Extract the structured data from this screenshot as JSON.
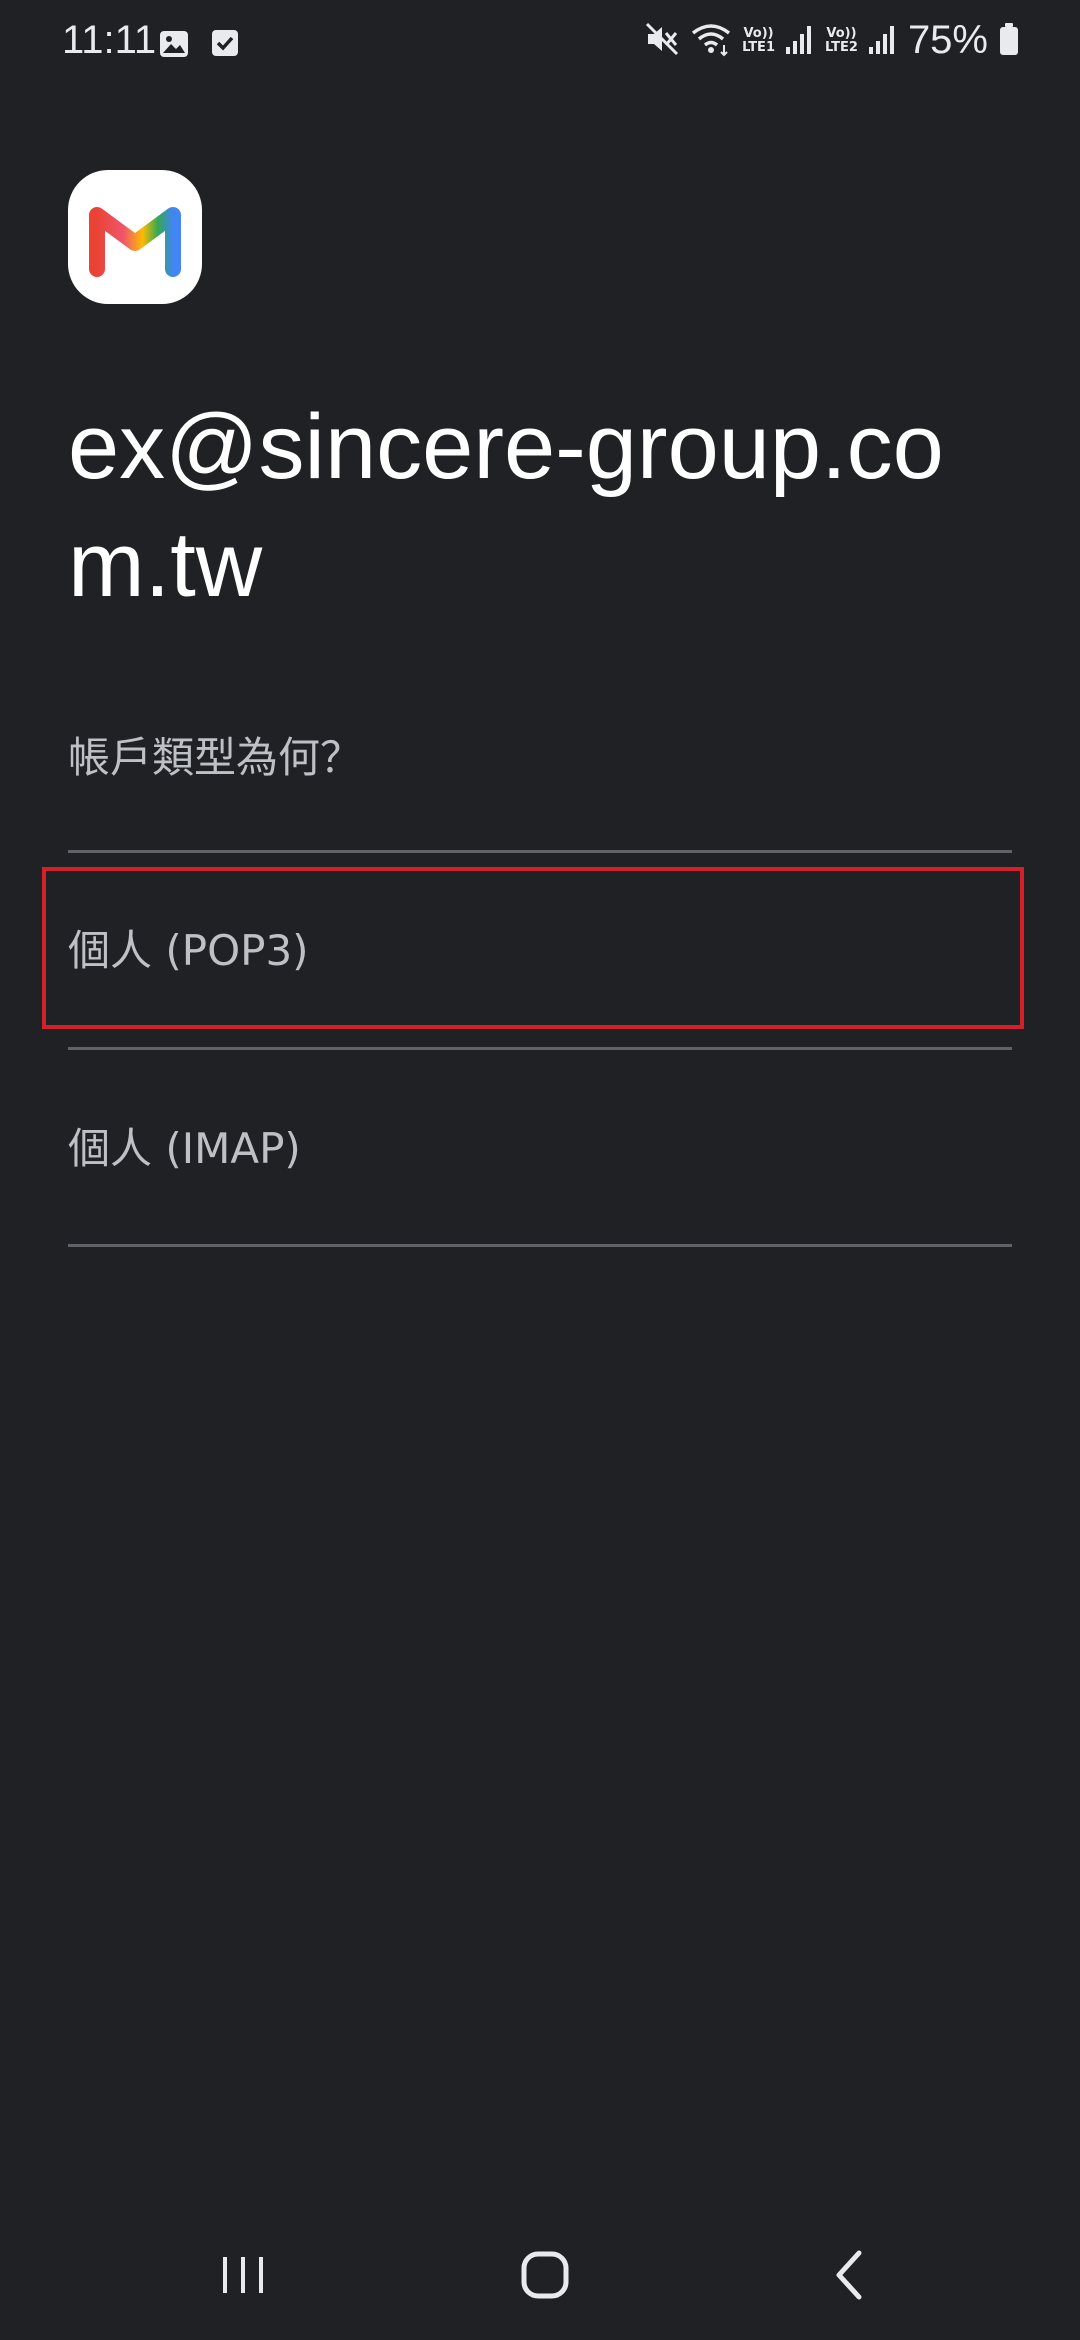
{
  "status_bar": {
    "time": "11:11",
    "battery": "75%",
    "sim1_tag_top": "Vo))",
    "sim1_tag_bottom": "LTE1",
    "sim2_tag_top": "Vo))",
    "sim2_tag_bottom": "LTE2",
    "icons": [
      "gallery-icon",
      "checkbox-icon",
      "mute-icon",
      "wifi-icon",
      "signal-icon",
      "battery-icon"
    ]
  },
  "header": {
    "email": "ex@sincere-group.com.tw"
  },
  "prompt": {
    "question": "帳戶類型為何？"
  },
  "options": [
    {
      "label": "個人 (POP3)",
      "highlighted": true
    },
    {
      "label": "個人 (IMAP)",
      "highlighted": false
    }
  ],
  "colors": {
    "background": "#202124",
    "highlight": "#d3212b",
    "divider": "#5f6368"
  },
  "nav": {
    "buttons": [
      "recent-apps",
      "home",
      "back"
    ]
  }
}
